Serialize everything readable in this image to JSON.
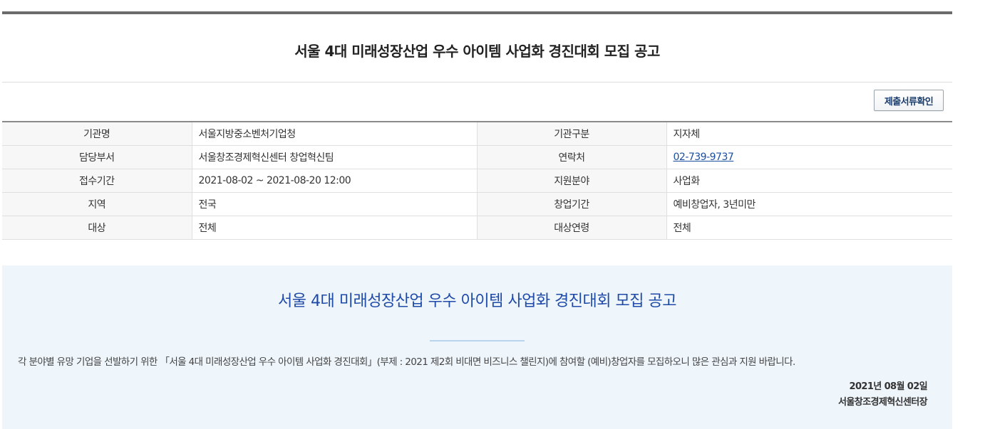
{
  "header": {
    "title": "서울 4대 미래성장산업 우수 아이템 사업화 경진대회 모집 공고"
  },
  "toolbar": {
    "docs_button_label": "제출서류확인"
  },
  "info": {
    "rows": [
      {
        "label1": "기관명",
        "value1": "서울지방중소벤처기업청",
        "label2": "기관구분",
        "value2": "지자체"
      },
      {
        "label1": "담당부서",
        "value1": "서울창조경제혁신센터 창업혁신팀",
        "label2": "연락처",
        "value2": "02-739-9737"
      },
      {
        "label1": "접수기간",
        "value1": "2021-08-02 ~ 2021-08-20 12:00",
        "label2": "지원분야",
        "value2": "사업화"
      },
      {
        "label1": "지역",
        "value1": "전국",
        "label2": "창업기간",
        "value2": "예비창업자, 3년미만"
      },
      {
        "label1": "대상",
        "value1": "전체",
        "label2": "대상연령",
        "value2": "전체"
      }
    ]
  },
  "notice": {
    "title": "서울 4대 미래성장산업 우수 아이템 사업화 경진대회 모집 공고",
    "body": "각 분야별 유망 기업을 선발하기 위한 「서울 4대 미래성장산업 우수 아이템 사업화 경진대회」(부제 : 2021 제2회 비대면 비즈니스 챌린지)에 참여할 (예비)창업자를 모집하오니 많은 관심과 지원 바랍니다.",
    "date": "2021년 08월 02일",
    "org": "서울창조경제혁신센터장"
  },
  "colors": {
    "accent_blue": "#1f4aa8",
    "link_blue": "#1a4fa0",
    "notice_bg": "#eef5fb"
  }
}
